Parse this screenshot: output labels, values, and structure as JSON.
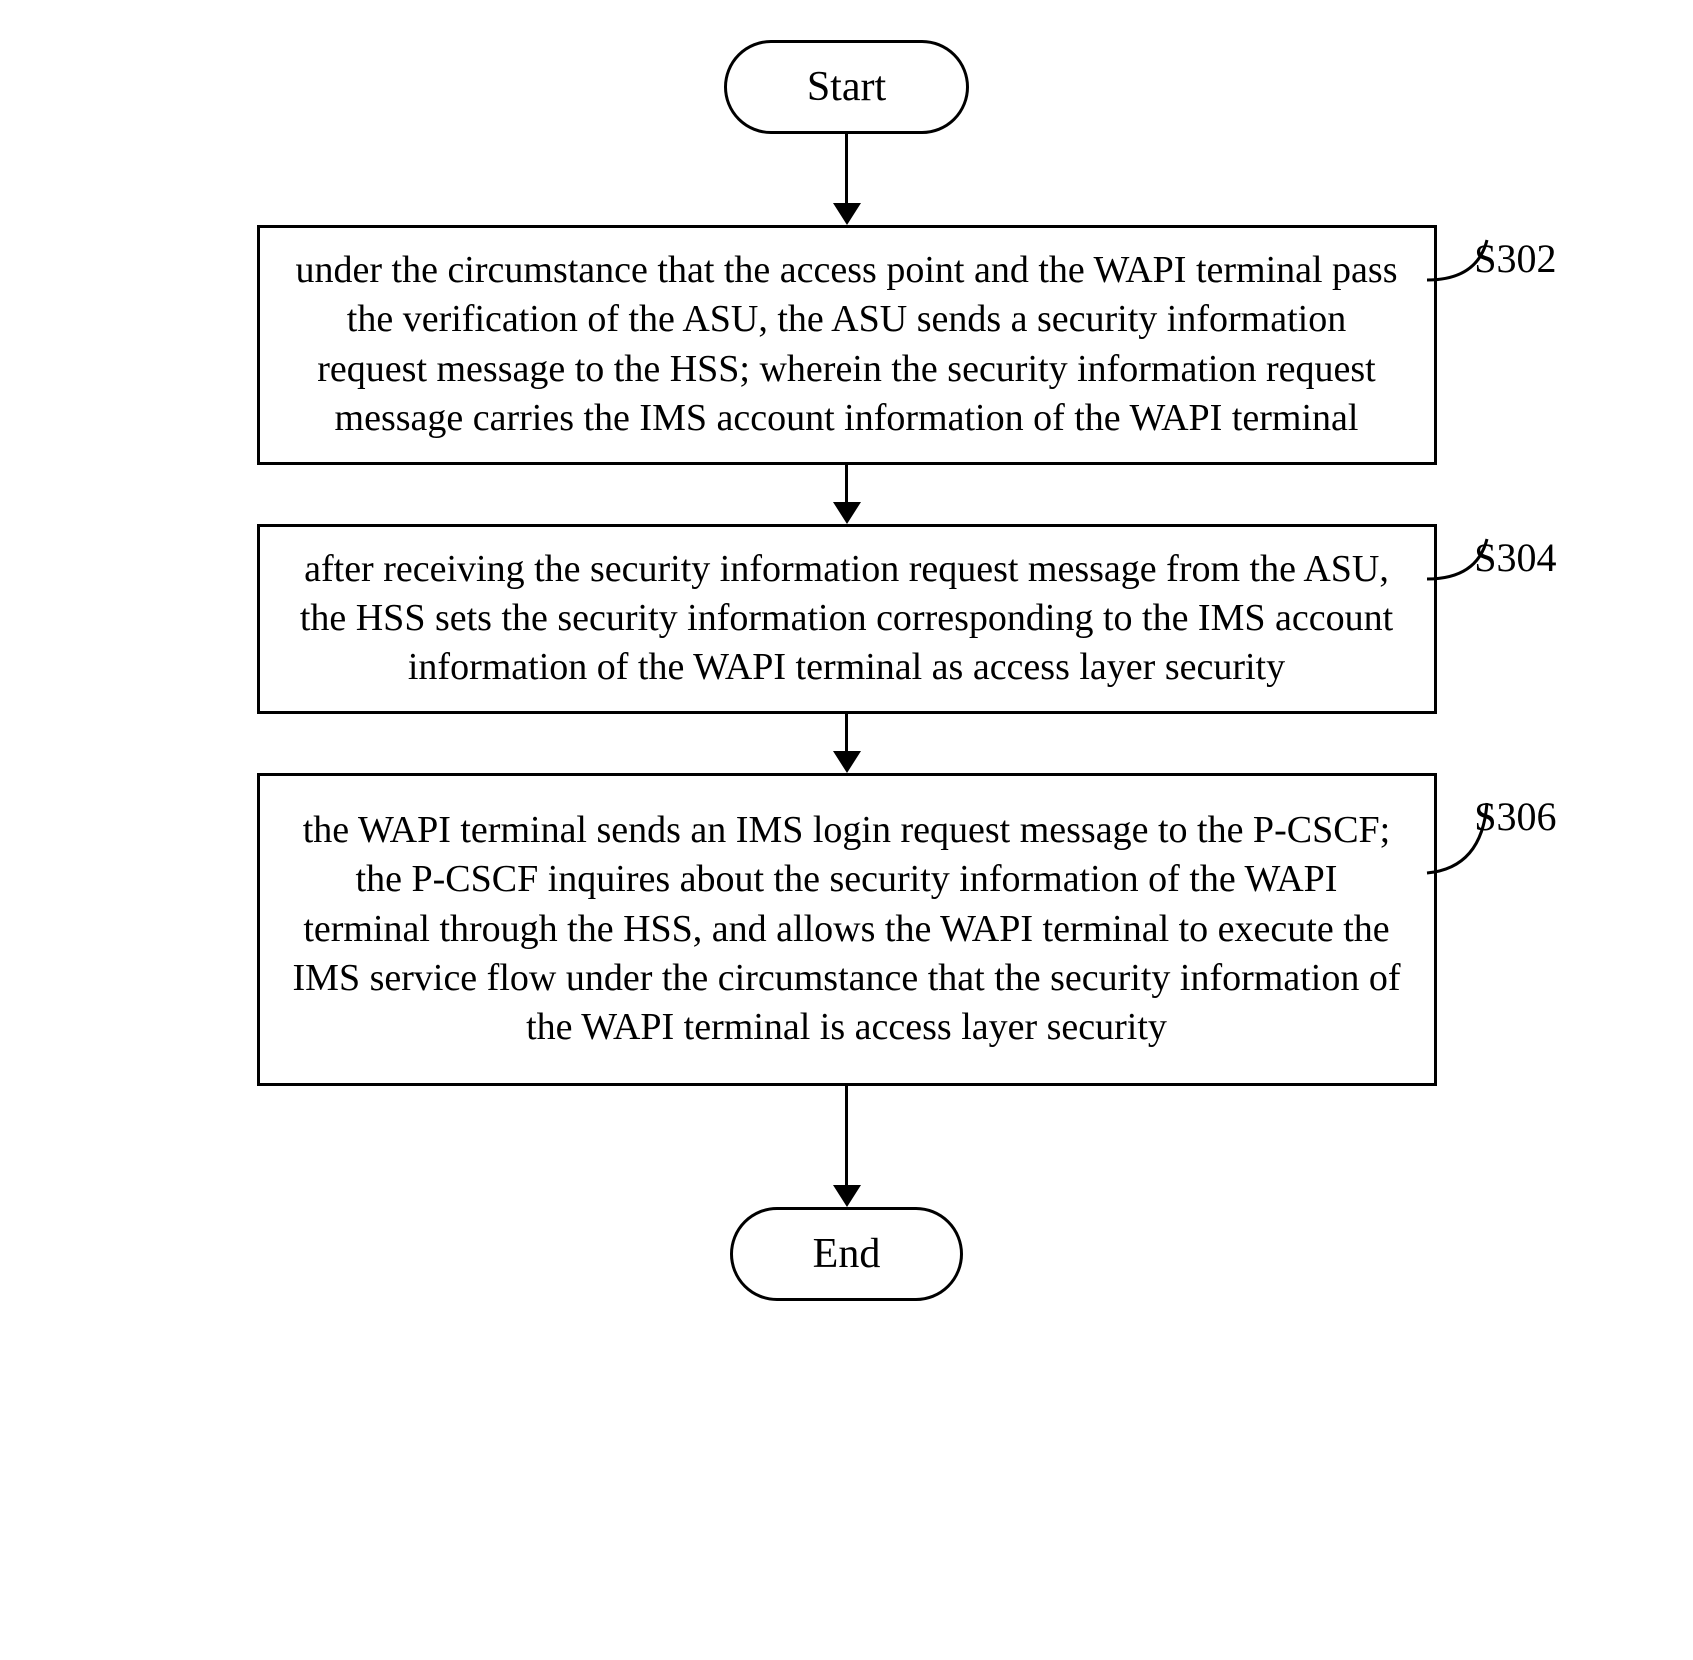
{
  "flowchart": {
    "start_label": "Start",
    "end_label": "End",
    "steps": [
      {
        "id": "S302",
        "text": "under the circumstance that the access point and the WAPI terminal pass the verification of the ASU, the ASU sends a security information request message to the HSS; wherein the security information request message carries the IMS account information of the WAPI terminal"
      },
      {
        "id": "S304",
        "text": "after receiving the security information request message from the ASU, the HSS sets the security information corresponding to the IMS account information of the WAPI terminal as access layer security"
      },
      {
        "id": "S306",
        "text": "the WAPI terminal sends an IMS login request message to the P-CSCF; the P-CSCF inquires about the security information of the WAPI terminal through the HSS, and allows the WAPI terminal to execute the IMS service flow under the circumstance that the security information of the WAPI terminal is access layer security"
      }
    ]
  }
}
